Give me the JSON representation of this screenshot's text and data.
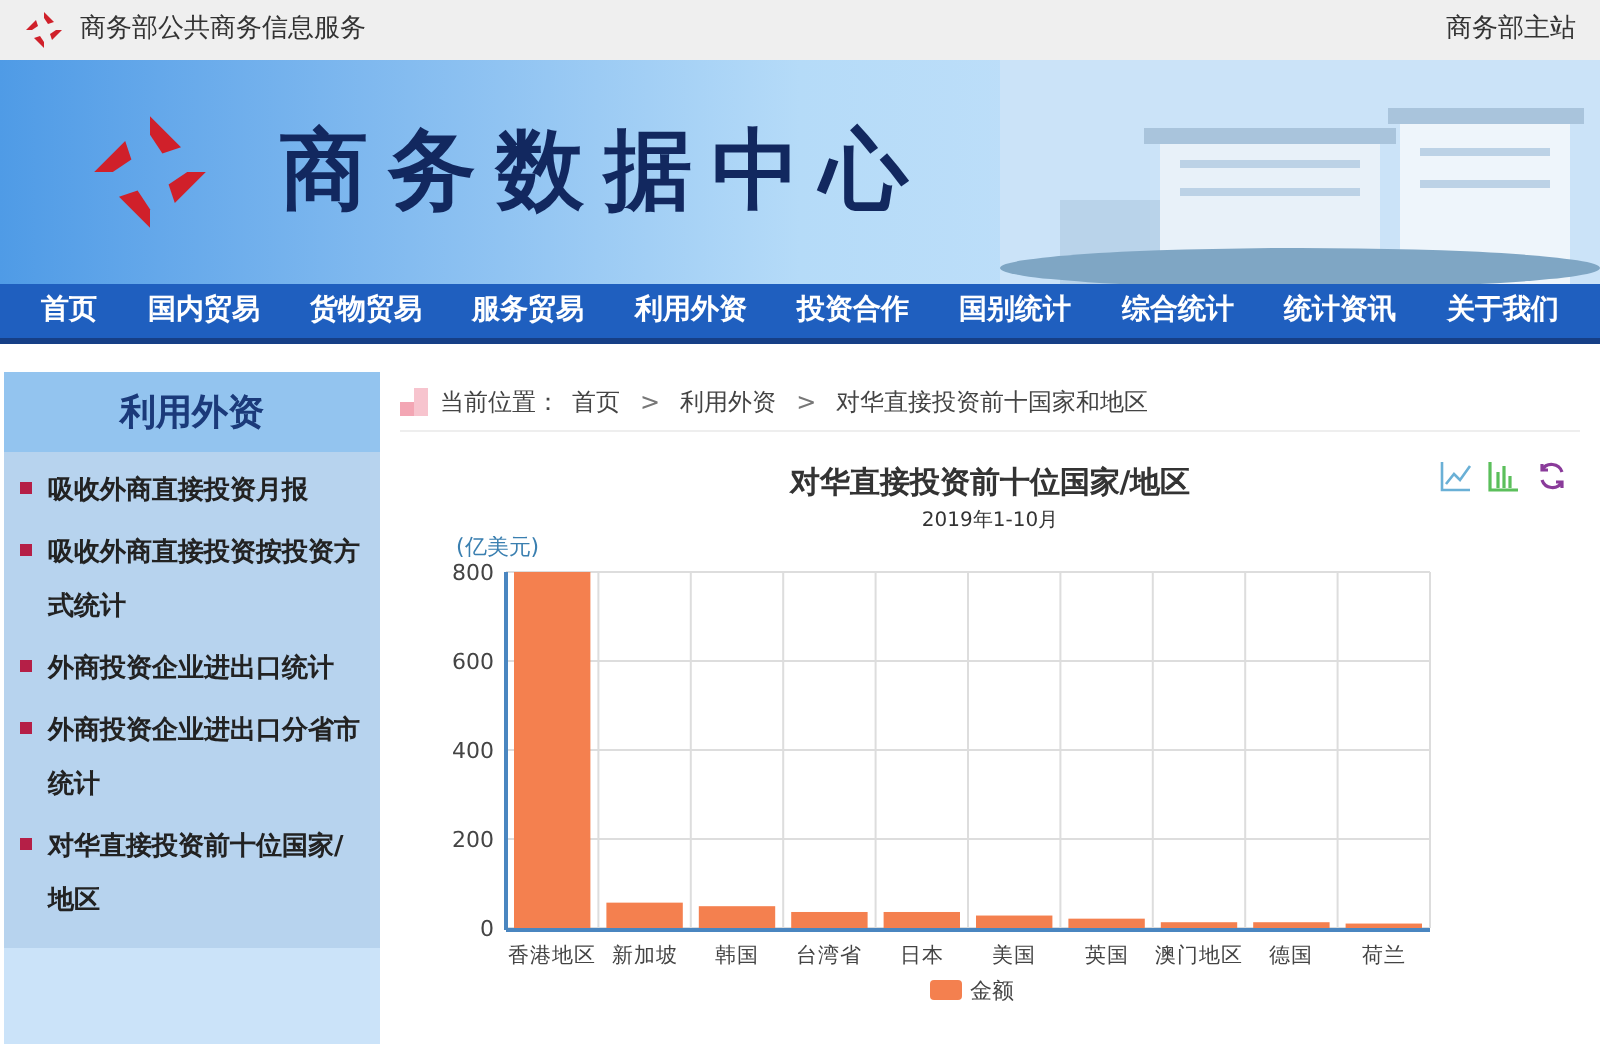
{
  "top_bar": {
    "site_name": "商务部公共商务信息服务",
    "main_site_link": "商务部主站"
  },
  "banner": {
    "title": "商务数据中心"
  },
  "nav": [
    {
      "label": "首页",
      "selected": false
    },
    {
      "label": "国内贸易",
      "selected": false
    },
    {
      "label": "货物贸易",
      "selected": false
    },
    {
      "label": "服务贸易",
      "selected": false
    },
    {
      "label": "利用外资",
      "selected": false
    },
    {
      "label": "投资合作",
      "selected": false
    },
    {
      "label": "国别统计",
      "selected": false
    },
    {
      "label": "综合统计",
      "selected": false
    },
    {
      "label": "统计资讯",
      "selected": false
    },
    {
      "label": "关于我们",
      "selected": false
    }
  ],
  "sidebar": {
    "title": "利用外资",
    "items": [
      {
        "label": "吸收外商直接投资月报"
      },
      {
        "label": "吸收外商直接投资按投资方式统计"
      },
      {
        "label": "外商投资企业进出口统计"
      },
      {
        "label": "外商投资企业进出口分省市统计"
      },
      {
        "label": "对华直接投资前十位国家/地区"
      }
    ]
  },
  "breadcrumb": {
    "prefix": "当前位置：",
    "items": [
      "首页",
      "利用外资",
      "对华直接投资前十国家和地区"
    ],
    "separators": [
      ">",
      ">"
    ]
  },
  "chart": {
    "subtitle": "2019年1-10月",
    "chart_data": {
      "type": "bar",
      "title": "对华直接投资前十位国家/地区",
      "ylabel": "(亿美元)",
      "categories": [
        "香港地区",
        "新加坡",
        "韩国",
        "台湾省",
        "日本",
        "美国",
        "英国",
        "澳门地区",
        "德国",
        "荷兰"
      ],
      "series": [
        {
          "name": "金额",
          "color": "#f4804f",
          "values": [
            800,
            57,
            49,
            36,
            36,
            28,
            21,
            13,
            13,
            10
          ]
        }
      ],
      "ylim": [
        0,
        800
      ],
      "yticks": [
        0,
        200,
        400,
        600,
        800
      ],
      "grid": true
    }
  }
}
